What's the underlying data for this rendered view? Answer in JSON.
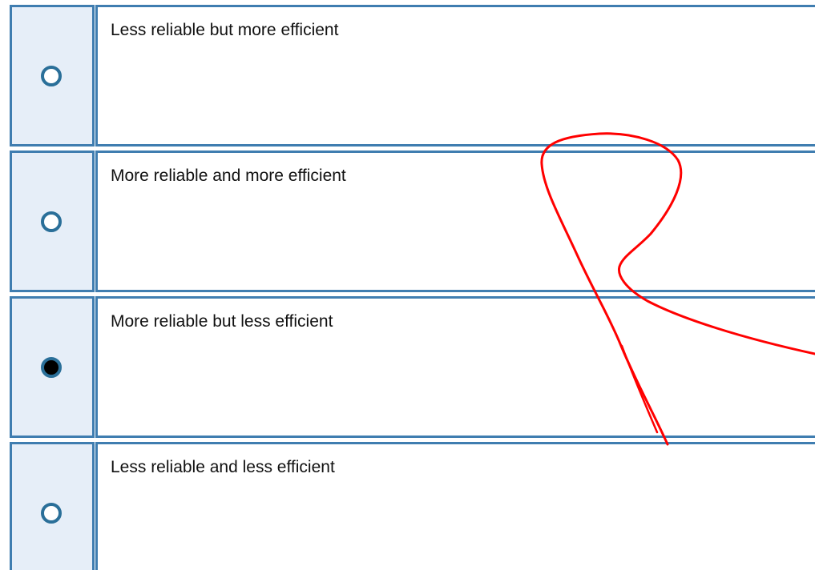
{
  "question": {
    "options": [
      {
        "label": "Less reliable but more efficient",
        "selected": false
      },
      {
        "label": "More reliable and more efficient",
        "selected": false
      },
      {
        "label": "More reliable but less efficient",
        "selected": true
      },
      {
        "label": "Less reliable and less efficient",
        "selected": false
      }
    ]
  },
  "colors": {
    "cell_border": "#3f7db0",
    "radio_cell_background": "#e6eef8",
    "radio_ring": "#2a6f99",
    "annotation_stroke": "#ff0000"
  }
}
